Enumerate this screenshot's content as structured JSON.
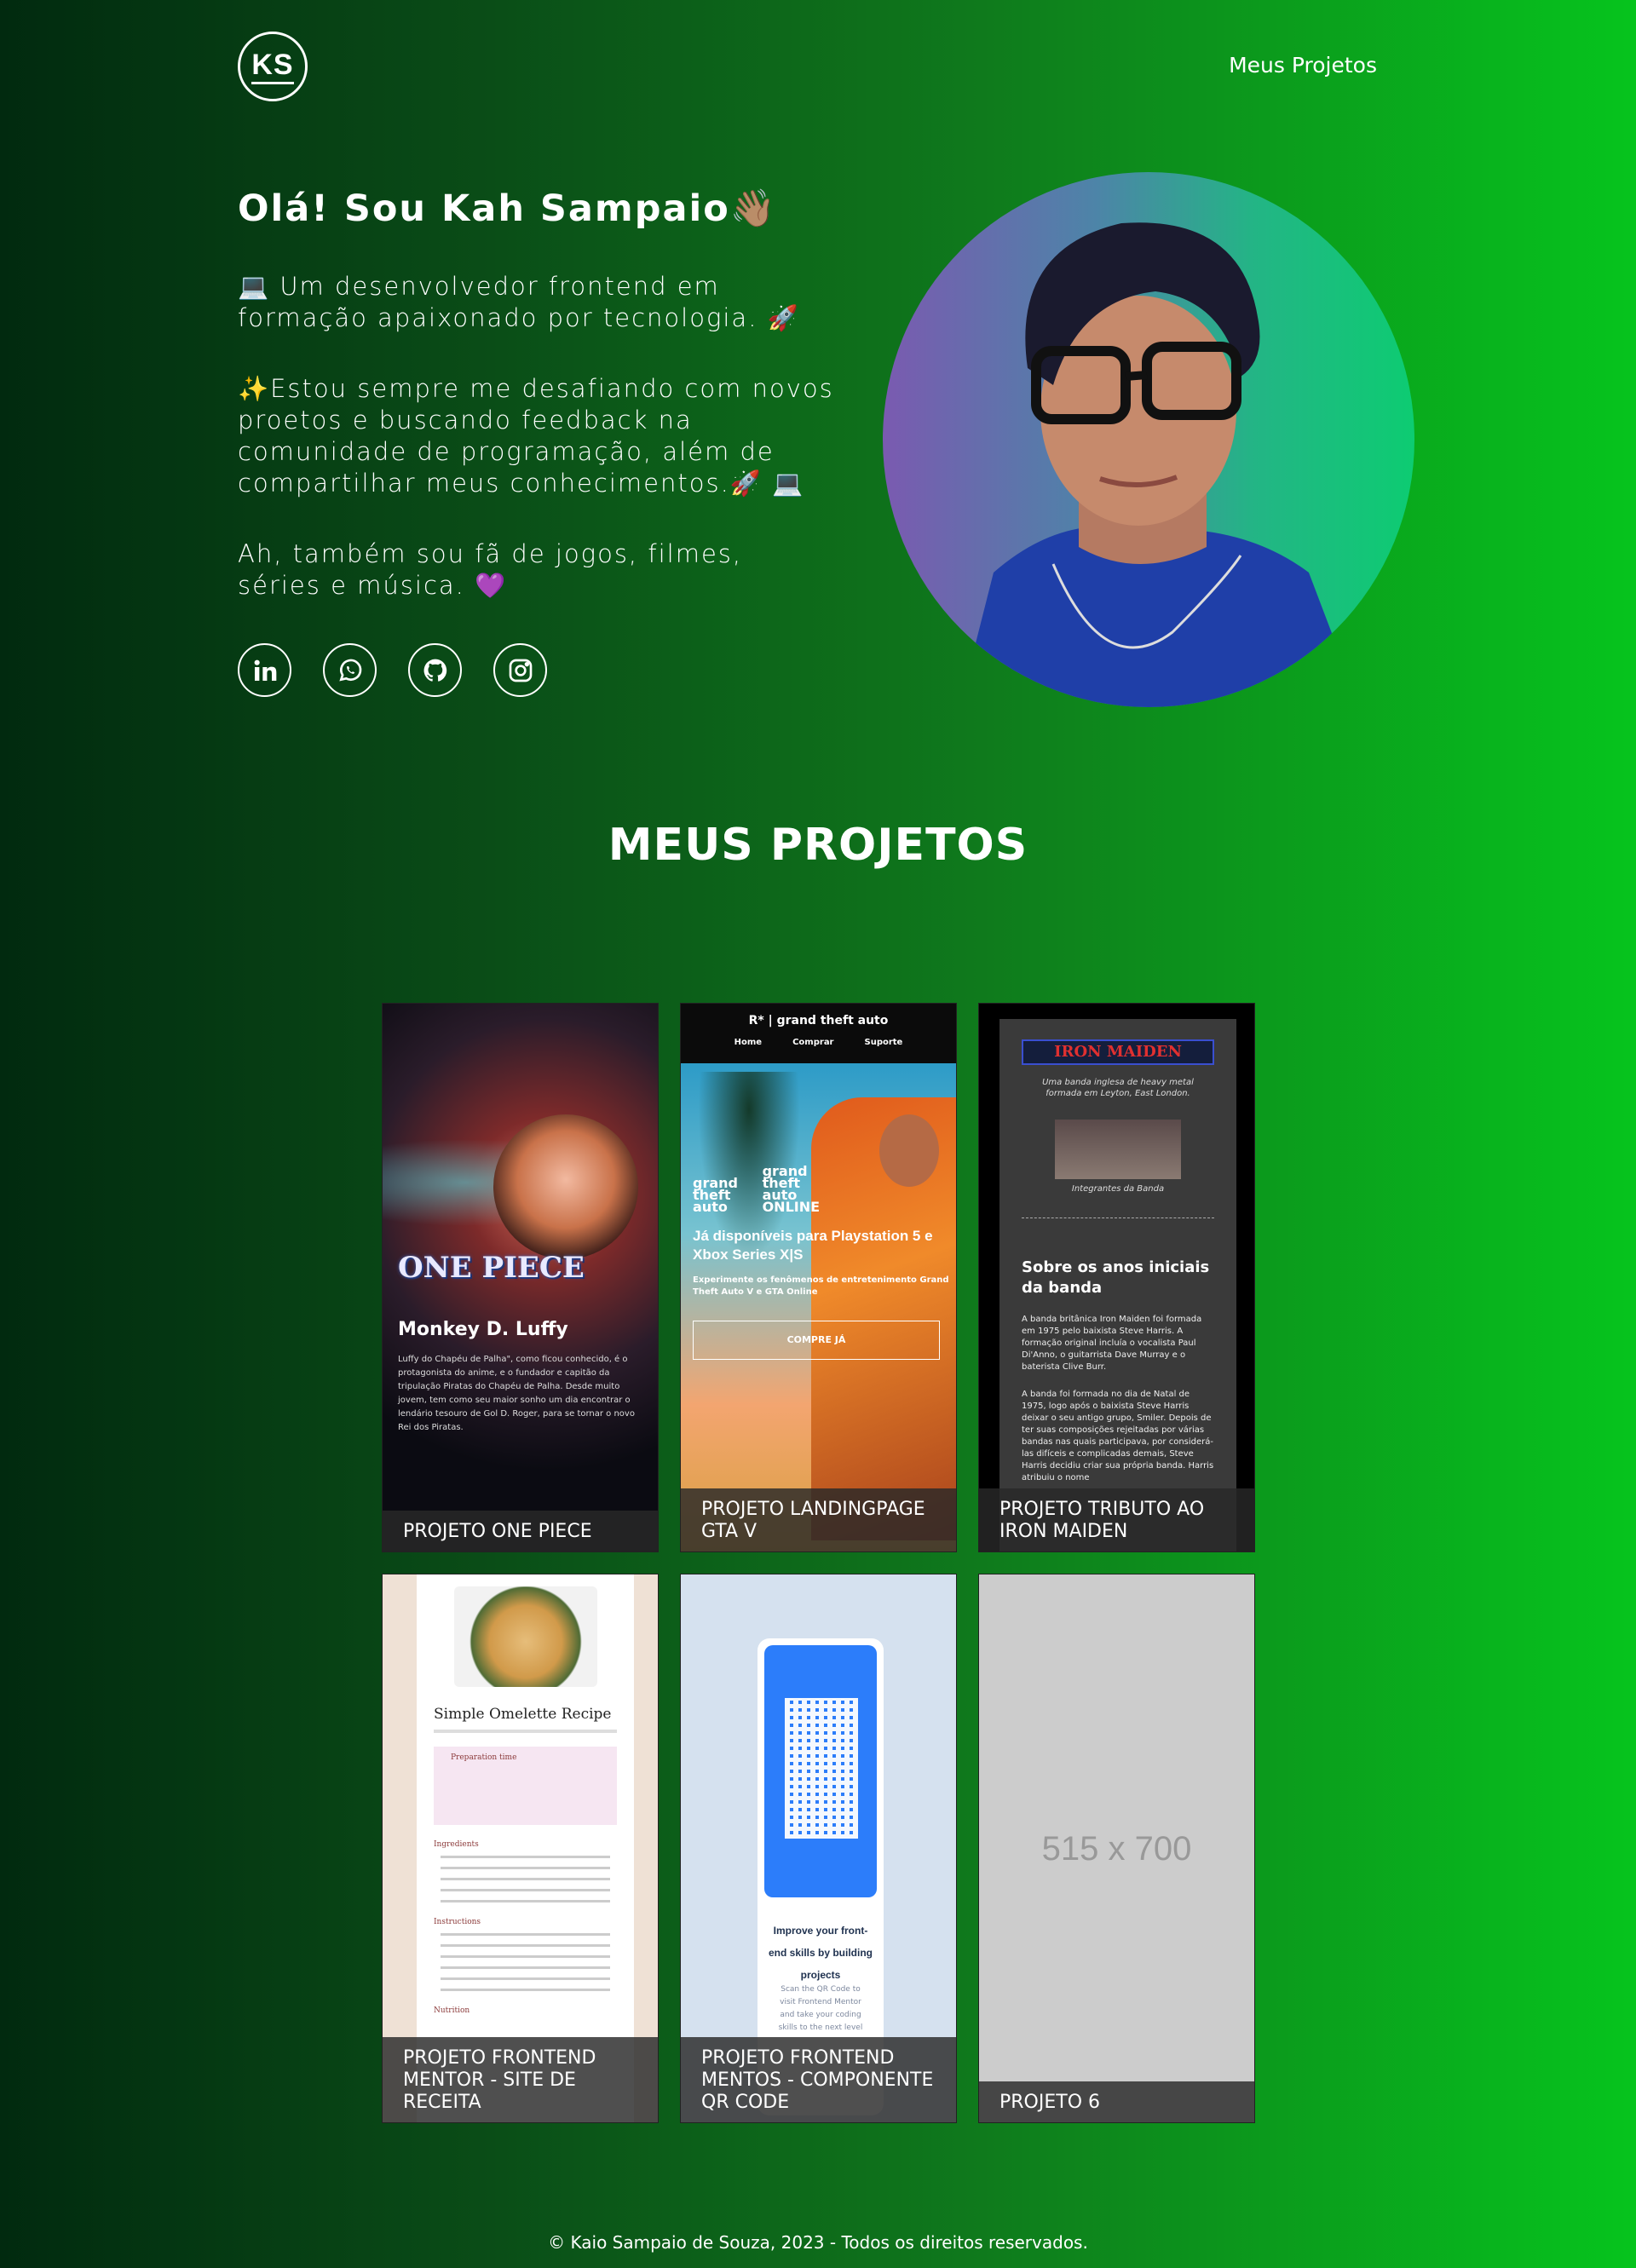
{
  "header": {
    "logo_text": "KS",
    "nav_link": "Meus Projetos"
  },
  "intro": {
    "heading": "Olá! Sou Kah Sampaio👋🏽",
    "p1": "💻 Um desenvolvedor frontend em formação apaixonado por tecnologia. 🚀",
    "p2": "✨Estou sempre me desafiando com novos proetos e buscando feedback na comunidade de programação, além de compartilhar meus conhecimentos.🚀 💻",
    "p3": "Ah, também sou fã de jogos, filmes, séries e música. 💜"
  },
  "social": [
    {
      "icon": "linkedin-icon"
    },
    {
      "icon": "whatsapp-icon"
    },
    {
      "icon": "github-icon"
    },
    {
      "icon": "instagram-icon"
    }
  ],
  "projects": {
    "title": "MEUS PROJETOS",
    "items": [
      {
        "caption": "PROJETO ONE PIECE",
        "preview": {
          "logo": "ONE PIECE",
          "name": "Monkey D. Luffy",
          "text": "Luffy do Chapéu de Palha\", como ficou conhecido, é o protagonista do anime, e o fundador e capitão da tripulação Piratas do Chapéu de Palha. Desde muito jovem, tem como seu maior sonho um dia encontrar o lendário tesouro de Gol D. Roger, para se tornar o novo Rei dos Piratas."
        }
      },
      {
        "caption": "PROJETO LANDINGPAGE GTA V",
        "preview": {
          "brand": "R* | grand theft auto",
          "nav": [
            "Home",
            "Comprar",
            "Suporte"
          ],
          "logo1": "grand theft auto",
          "logo2": "grand theft auto ONLINE",
          "headline": "Já disponíveis para Playstation 5 e Xbox Series X|S",
          "sub": "Experimente os fenômenos de entretenimento Grand Theft Auto V e GTA Online",
          "button": "COMPRE JÁ"
        }
      },
      {
        "caption": "PROJETO TRIBUTO AO IRON MAIDEN",
        "preview": {
          "logo": "IRON MAIDEN",
          "desc": "Uma banda inglesa de heavy metal formada em Leyton, East London.",
          "photo_caption": "Integrantes da Banda",
          "h2": "Sobre os anos iniciais da banda",
          "p1": "A banda britânica Iron Maiden foi formada em 1975 pelo baixista Steve Harris. A formação original incluía o vocalista Paul Di'Anno, o guitarrista Dave Murray e o baterista Clive Burr.",
          "p2": "A banda foi formada no dia de Natal de 1975, logo após o baixista Steve Harris deixar o seu antigo grupo, Smiler. Depois de ter suas composições rejeitadas por várias bandas nas quais participava, por considerá-las difíceis e complicadas demais, Steve Harris decidiu criar sua própria banda. Harris atribuiu o nome"
        }
      },
      {
        "caption": "PROJETO FRONTEND MENTOR - SITE DE RECEITA",
        "preview": {
          "title": "Simple Omelette Recipe",
          "sec1": "Preparation time",
          "sec2": "Ingredients",
          "sec3": "Instructions",
          "sec4": "Nutrition"
        }
      },
      {
        "caption": "PROJETO FRONTEND MENTOS - COMPONENTE QR CODE",
        "preview": {
          "headline": "Improve your front-end skills by building projects",
          "sub": "Scan the QR Code to visit Frontend Mentor and take your coding skills to the next level"
        }
      },
      {
        "caption": "PROJETO 6",
        "preview": {
          "placeholder": "515 x 700"
        }
      }
    ]
  },
  "footer": {
    "text": "© Kaio Sampaio de Souza, 2023 - Todos os direitos reservados."
  }
}
